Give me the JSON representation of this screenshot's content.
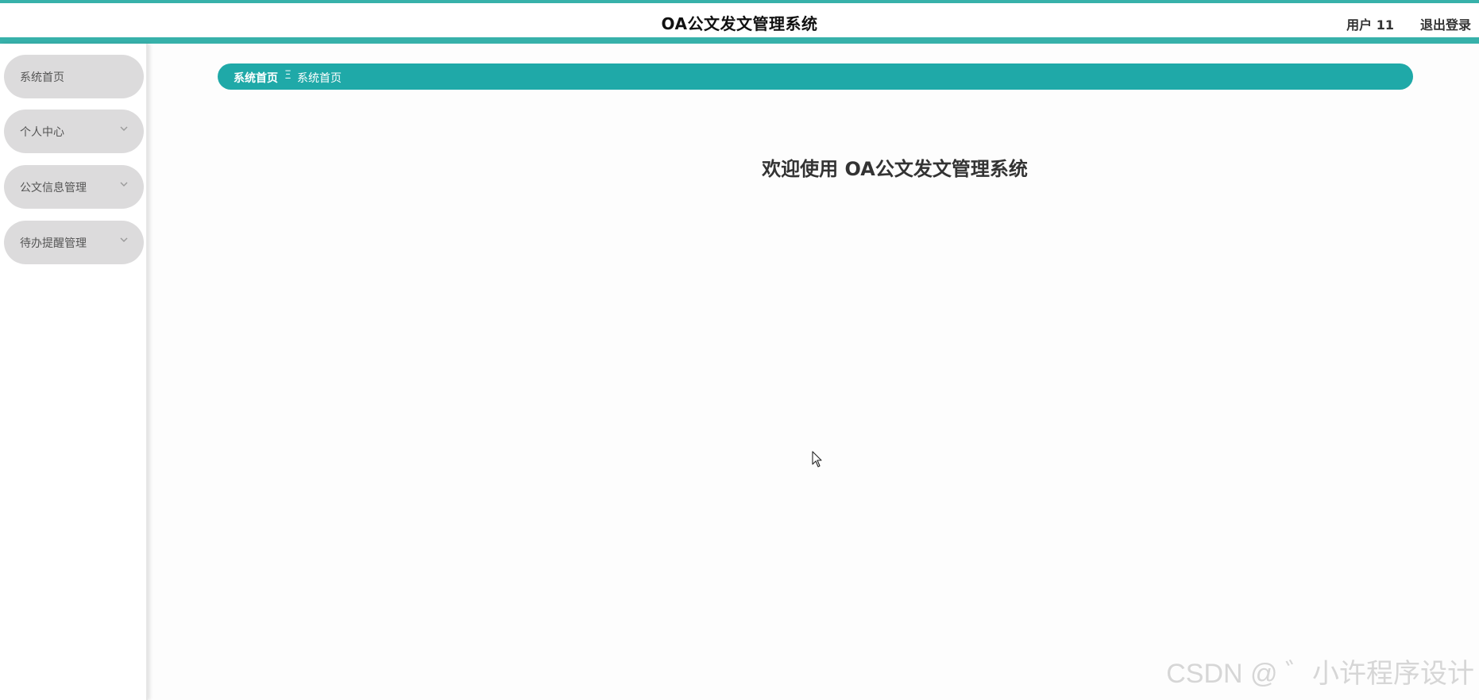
{
  "header": {
    "title": "OA公文发文管理系统",
    "user": "用户 11",
    "logout": "退出登录",
    "accent_color": "#37b1aa"
  },
  "sidebar": {
    "items": [
      {
        "label": "系统首页",
        "has_chevron": false
      },
      {
        "label": "个人中心",
        "has_chevron": true,
        "icon": "chevron-down-icon"
      },
      {
        "label": "公文信息管理",
        "has_chevron": true,
        "icon": "chevron-down-icon"
      },
      {
        "label": "待办提醒管理",
        "has_chevron": true,
        "icon": "chevron-down-icon"
      }
    ]
  },
  "breadcrumb": {
    "first": "系统首页",
    "separator": "Ξ",
    "second": "系统首页",
    "color": "#1fa9a8"
  },
  "main": {
    "welcome": "欢迎使用 OA公文发文管理系统"
  },
  "watermark": "CSDN @ ゛小许程序设计"
}
